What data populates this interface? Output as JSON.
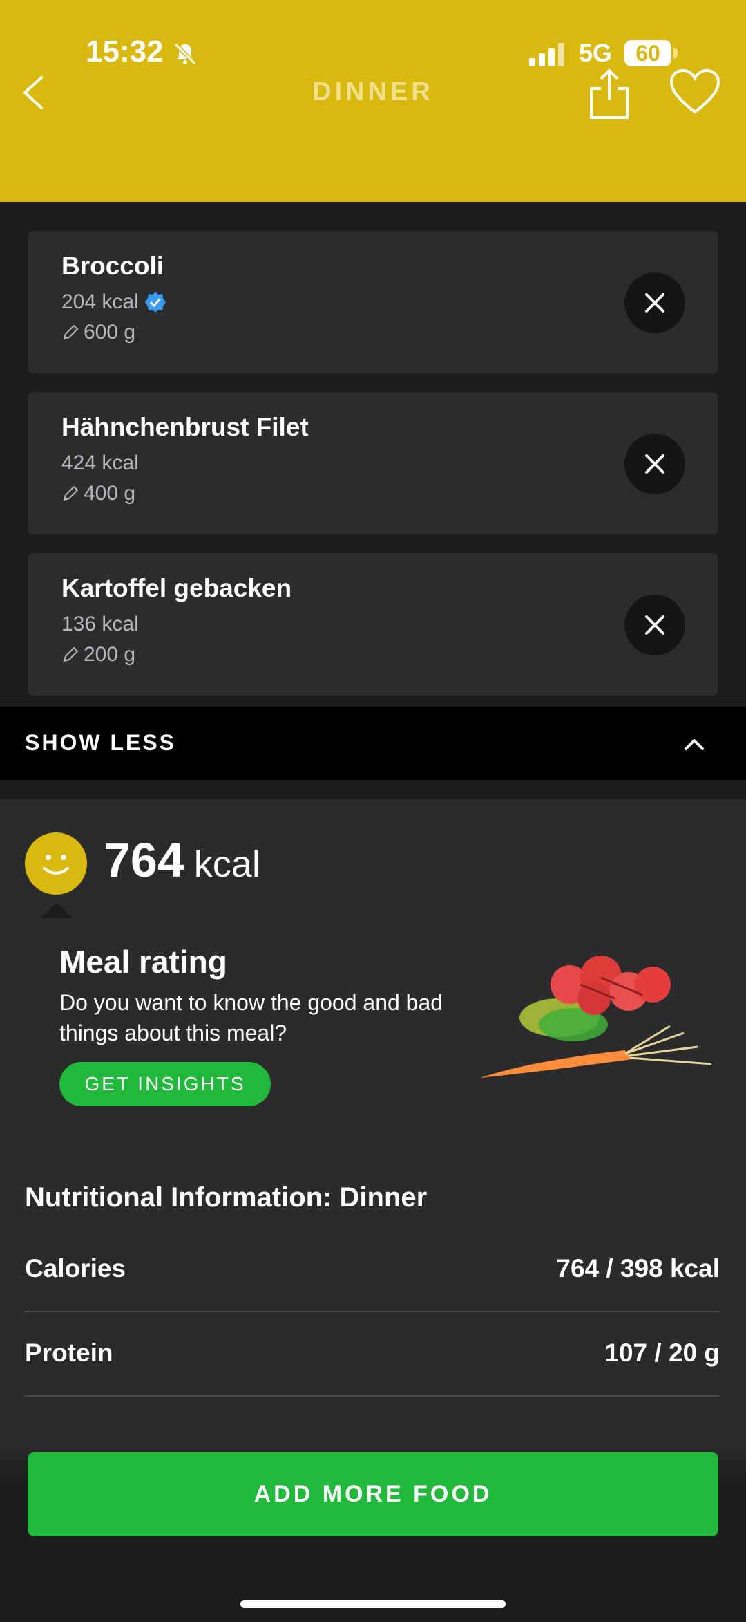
{
  "status_bar": {
    "time": "15:32",
    "network": "5G",
    "battery": "60"
  },
  "header": {
    "title": "DINNER"
  },
  "foods": [
    {
      "name": "Broccoli",
      "kcal": "204 kcal",
      "weight": "600 g",
      "verified": true
    },
    {
      "name": "Hähnchenbrust Filet",
      "kcal": "424 kcal",
      "weight": "400 g",
      "verified": false
    },
    {
      "name": "Kartoffel gebacken",
      "kcal": "136 kcal",
      "weight": "200 g",
      "verified": false
    }
  ],
  "show_less": {
    "label": "SHOW LESS"
  },
  "summary": {
    "kcal_value": "764",
    "kcal_unit": "kcal"
  },
  "meal_rating": {
    "title": "Meal rating",
    "text": "Do you want to know the good and bad things about this meal?",
    "button": "GET INSIGHTS"
  },
  "nutrition": {
    "title": "Nutritional Information: Dinner",
    "rows": [
      {
        "label": "Calories",
        "value": "764 / 398 kcal"
      },
      {
        "label": "Protein",
        "value": "107 / 20 g"
      }
    ]
  },
  "add_more": {
    "label": "ADD MORE FOOD"
  },
  "colors": {
    "header": "#d9b80f",
    "accent_green": "#21b83b",
    "verified_blue": "#3a9cf0"
  }
}
